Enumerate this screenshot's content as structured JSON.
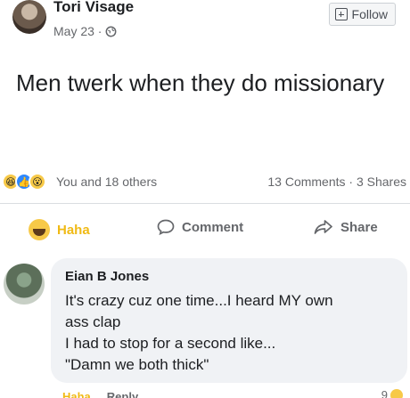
{
  "post": {
    "author": "Tori Visage",
    "date": "May 23 ·",
    "follow_label": "Follow",
    "text": "Men twerk when they do missionary"
  },
  "stats": {
    "reactors": "You and 18 others",
    "counts": "13 Comments · 3 Shares"
  },
  "actions": {
    "haha": "Haha",
    "comment": "Comment",
    "share": "Share"
  },
  "comment": {
    "author": "Eian B Jones",
    "lines": [
      "It's crazy cuz one time...I heard MY own",
      "ass clap",
      "I had to stop for a second like...",
      "\"Damn we both thick\""
    ],
    "reaction_label": "Haha",
    "reply_label": "Reply",
    "reaction_count": "9"
  },
  "icons": {
    "globe": "globe-icon",
    "plus": "plus-icon",
    "comment": "comment-icon",
    "share": "share-icon",
    "haha": "haha-reaction-icon"
  },
  "colors": {
    "haha_accent": "#f0ba15",
    "like_blue": "#2d88ff",
    "bubble_bg": "#f0f2f5",
    "secondary_text": "#65676b"
  }
}
